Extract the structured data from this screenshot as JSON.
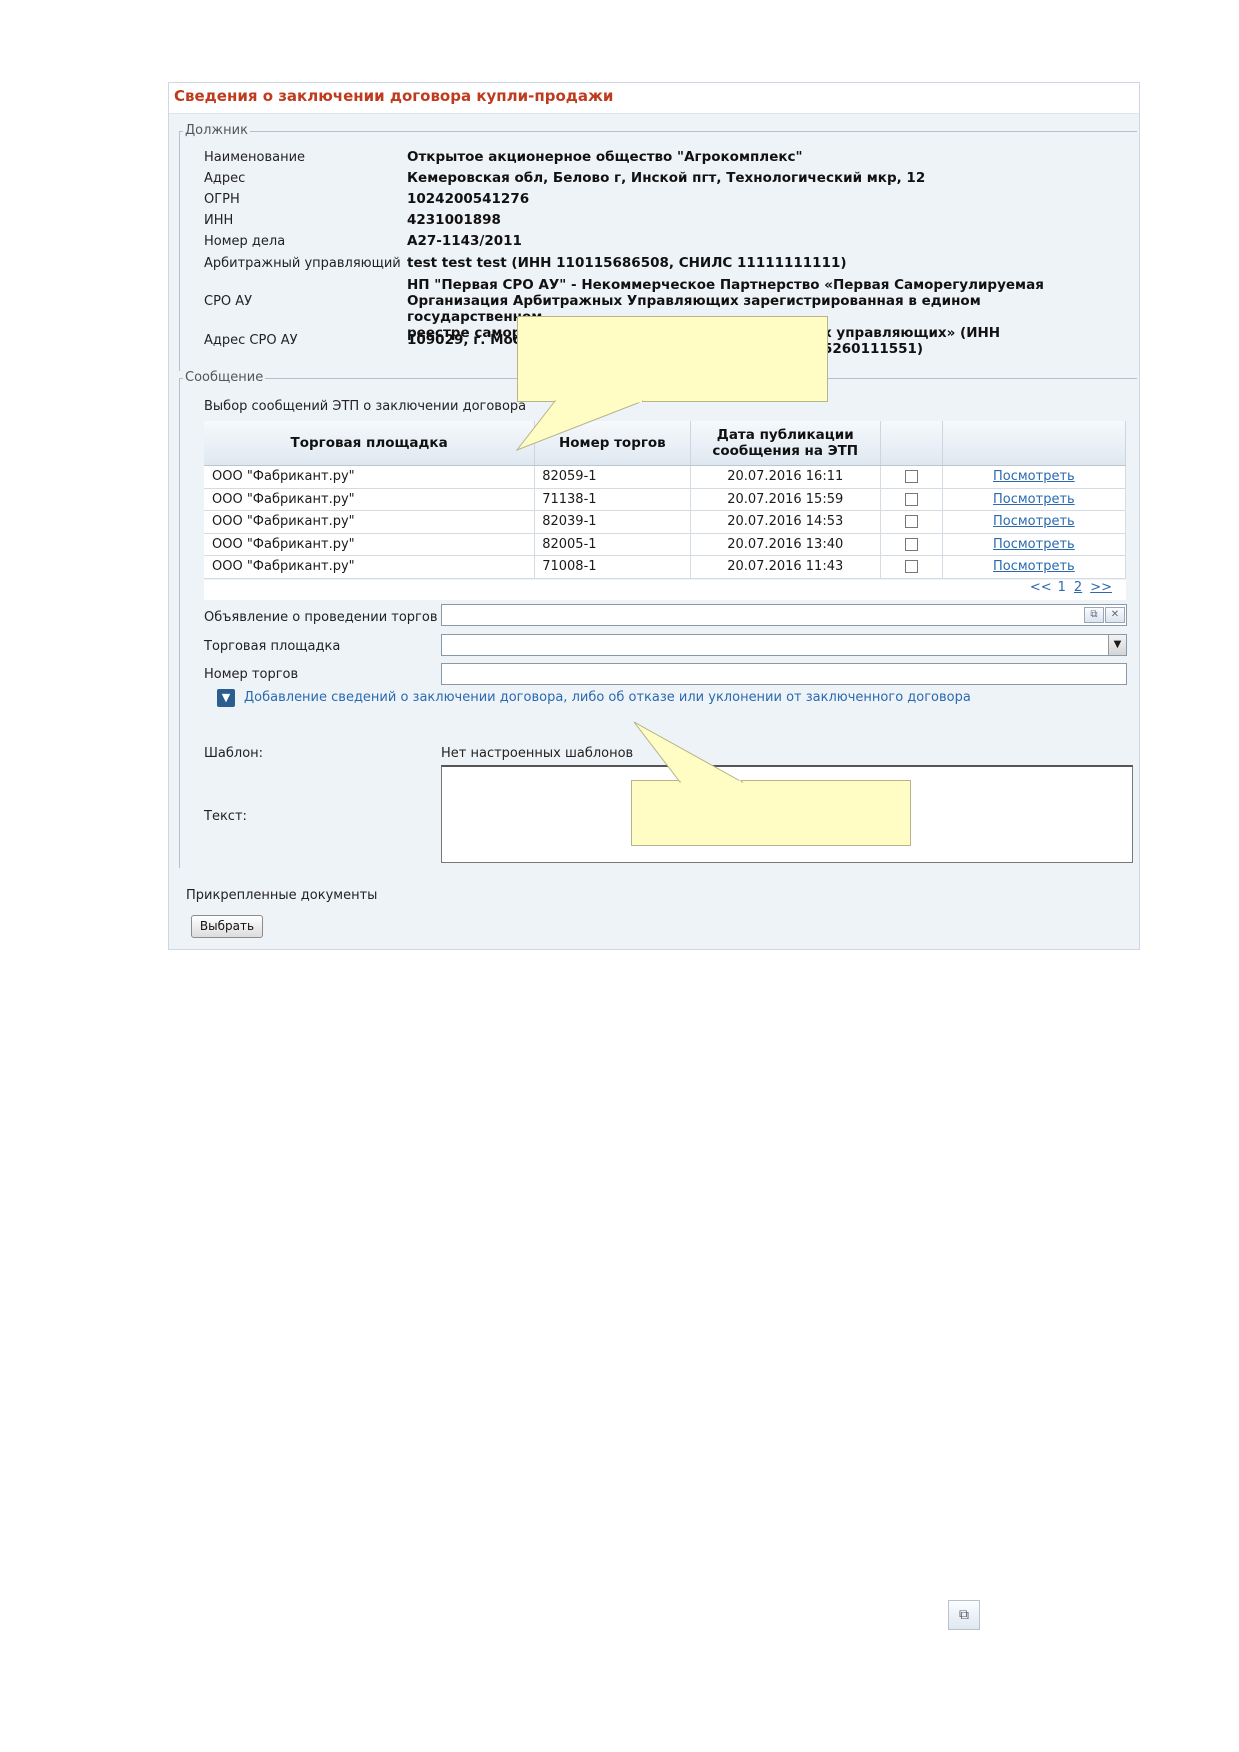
{
  "panel": {
    "title": "Сведения о заключении договора купли-продажи"
  },
  "debtor": {
    "legend": "Должник",
    "rows": [
      {
        "label": "Наименование",
        "value": "Открытое акционерное общество \"Агрокомплекс\""
      },
      {
        "label": "Адрес",
        "value": "Кемеровская обл, Белово г, Инской пгт, Технологический мкр, 12"
      },
      {
        "label": "ОГРН",
        "value": "1024200541276"
      },
      {
        "label": "ИНН",
        "value": "4231001898"
      },
      {
        "label": "Номер дела",
        "value": "А27-1143/2011"
      },
      {
        "label": "Арбитражный управляющий",
        "value": "test test test (ИНН 110115686508, СНИЛС 11111111111)"
      },
      {
        "label": "СРО АУ",
        "value_lines": [
          "НП \"Первая СРО АУ\" - Некоммерческое Партнерство «Первая Саморегулируемая",
          "Организация Арбитражных Управляющих зарегистрированная в едином государственном",
          "реестре самор",
          "х управляющих» (ИНН 5260111551)"
        ]
      },
      {
        "label": "Адрес СРО АУ",
        "value": "109029, г. Мос"
      }
    ]
  },
  "message": {
    "legend": "Сообщение",
    "etp_select_label": "Выбор сообщений ЭТП о заключении договора",
    "table": {
      "headers": [
        "Торговая площадка",
        "Номер торгов",
        "Дата публикации сообщения на ЭТП",
        "",
        ""
      ],
      "rows": [
        {
          "platform": "ООО \"Фабрикант.ру\"",
          "number": "82059-1",
          "date": "20.07.2016 16:11",
          "checked": false,
          "action": "Посмотреть"
        },
        {
          "platform": "ООО \"Фабрикант.ру\"",
          "number": "71138-1",
          "date": "20.07.2016 15:59",
          "checked": false,
          "action": "Посмотреть"
        },
        {
          "platform": "ООО \"Фабрикант.ру\"",
          "number": "82039-1",
          "date": "20.07.2016 14:53",
          "checked": false,
          "action": "Посмотреть"
        },
        {
          "platform": "ООО \"Фабрикант.ру\"",
          "number": "82005-1",
          "date": "20.07.2016 13:40",
          "checked": false,
          "action": "Посмотреть"
        },
        {
          "platform": "ООО \"Фабрикант.ру\"",
          "number": "71008-1",
          "date": "20.07.2016 11:43",
          "checked": false,
          "action": "Посмотреть"
        }
      ]
    },
    "pager": {
      "prev": "<<",
      "page1": "1",
      "page2": "2",
      "next": ">>"
    },
    "form": {
      "announcement_label": "Объявление о проведении торгов",
      "announcement_value": "",
      "platform_label": "Торговая площадка",
      "platform_value": "",
      "auction_number_label": "Номер торгов",
      "auction_number_value": ""
    },
    "expander_label": "Добавление сведений о заключении договора, либо об отказе или уклонении от заключенного договора",
    "template_label": "Шаблон:",
    "template_value": "Нет настроенных шаблонов",
    "text_label": "Текст:",
    "text_value": ""
  },
  "attachments": {
    "label": "Прикрепленные документы",
    "select_button": "Выбрать"
  },
  "icons": {
    "lookup": "lookup-window-icon",
    "clear": "clear-x-icon",
    "dropdown": "chevron-down-icon",
    "expander": "chevron-down-icon"
  },
  "colors": {
    "title": "#c03a1e",
    "link": "#2a69b0",
    "panel_bg": "#eef3f8",
    "callout": "#fffdc4"
  }
}
